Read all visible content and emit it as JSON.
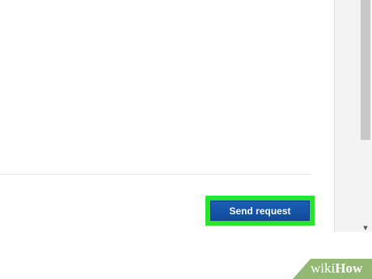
{
  "form": {
    "send_request_label": "Send request"
  },
  "watermark": {
    "wiki": "wiki",
    "how": "How"
  },
  "colors": {
    "highlight": "#27e52b",
    "button": "#1558ad",
    "watermark_bg": "#93b874"
  },
  "scrollbar": {
    "down_arrow_icon": "chevron-down-icon"
  }
}
